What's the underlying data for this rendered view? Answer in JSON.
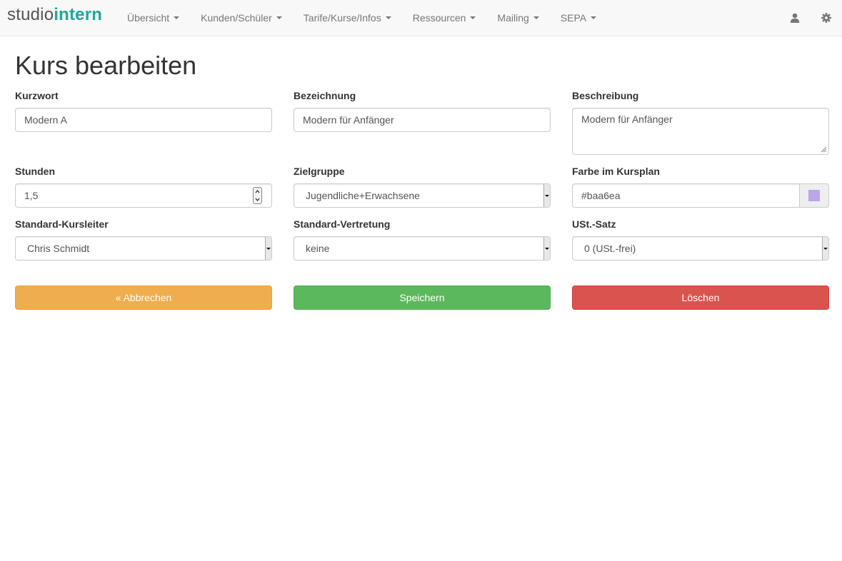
{
  "brand": {
    "part1": "studio",
    "part2": "intern"
  },
  "nav": {
    "items": [
      {
        "label": "Übersicht"
      },
      {
        "label": "Kunden/Schüler"
      },
      {
        "label": "Tarife/Kurse/Infos"
      },
      {
        "label": "Ressourcen"
      },
      {
        "label": "Mailing"
      },
      {
        "label": "SEPA"
      }
    ],
    "right_icons": [
      "user-icon",
      "gear-icon"
    ]
  },
  "page": {
    "title": "Kurs bearbeiten"
  },
  "form": {
    "kurzwort": {
      "label": "Kurzwort",
      "value": "Modern A"
    },
    "bezeichnung": {
      "label": "Bezeichnung",
      "value": "Modern für Anfänger"
    },
    "beschreibung": {
      "label": "Beschreibung",
      "value": "Modern für Anfänger"
    },
    "stunden": {
      "label": "Stunden",
      "value": "1,5"
    },
    "zielgruppe": {
      "label": "Zielgruppe",
      "value": "Jugendliche+Erwachsene"
    },
    "farbe": {
      "label": "Farbe im Kursplan",
      "value": "#baa6ea",
      "swatch_color": "#baa6ea"
    },
    "kursleiter": {
      "label": "Standard-Kursleiter",
      "value": "Chris Schmidt"
    },
    "vertretung": {
      "label": "Standard-Vertretung",
      "value": "keine"
    },
    "ust": {
      "label": "USt.-Satz",
      "value": "0 (USt.-frei)"
    }
  },
  "actions": {
    "cancel_label": "« Abbrechen",
    "save_label": "Speichern",
    "delete_label": "Löschen"
  },
  "colors": {
    "brand_accent": "#1aa99a",
    "warning": "#f0ad4e",
    "success": "#5cb85c",
    "danger": "#d9534f"
  }
}
